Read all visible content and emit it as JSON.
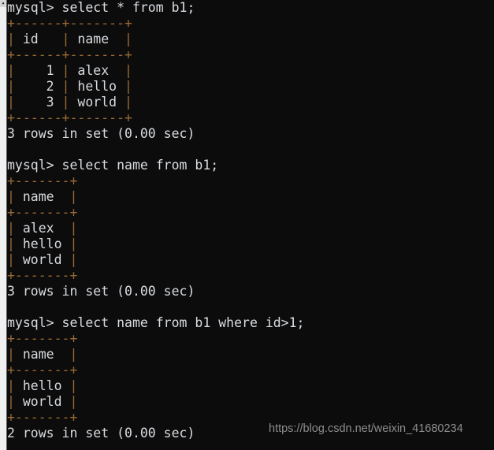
{
  "window": {
    "background_color": "#0c0c0c",
    "text_color": "#d8dbe0",
    "rule_color": "#9a6a33",
    "scrollbar_color": "#f0f0f0"
  },
  "scrollbar": {
    "up_arrow_glyph": "▲",
    "name": "vertical-scrollbar"
  },
  "terminal": {
    "lines": [
      {
        "type": "prompt",
        "text": "mysql> select * from b1;"
      },
      {
        "type": "rule",
        "text": "+------+-------+"
      },
      {
        "type": "row",
        "text": "| id   | name  |"
      },
      {
        "type": "rule",
        "text": "+------+-------+"
      },
      {
        "type": "row",
        "text": "|    1 | alex  |"
      },
      {
        "type": "row",
        "text": "|    2 | hello |"
      },
      {
        "type": "row",
        "text": "|    3 | world |"
      },
      {
        "type": "rule",
        "text": "+------+-------+"
      },
      {
        "type": "status",
        "text": "3 rows in set (0.00 sec)"
      },
      {
        "type": "blank",
        "text": " "
      },
      {
        "type": "prompt",
        "text": "mysql> select name from b1;"
      },
      {
        "type": "rule",
        "text": "+-------+"
      },
      {
        "type": "row",
        "text": "| name  |"
      },
      {
        "type": "rule",
        "text": "+-------+"
      },
      {
        "type": "row",
        "text": "| alex  |"
      },
      {
        "type": "row",
        "text": "| hello |"
      },
      {
        "type": "row",
        "text": "| world |"
      },
      {
        "type": "rule",
        "text": "+-------+"
      },
      {
        "type": "status",
        "text": "3 rows in set (0.00 sec)"
      },
      {
        "type": "blank",
        "text": " "
      },
      {
        "type": "prompt",
        "text": "mysql> select name from b1 where id>1;"
      },
      {
        "type": "rule",
        "text": "+-------+"
      },
      {
        "type": "row",
        "text": "| name  |"
      },
      {
        "type": "rule",
        "text": "+-------+"
      },
      {
        "type": "row",
        "text": "| hello |"
      },
      {
        "type": "row",
        "text": "| world |"
      },
      {
        "type": "rule",
        "text": "+-------+"
      },
      {
        "type": "status",
        "text": "2 rows in set (0.00 sec)"
      }
    ]
  },
  "queries": [
    {
      "sql": "select * from b1;",
      "columns": [
        "id",
        "name"
      ],
      "rows": [
        [
          "1",
          "alex"
        ],
        [
          "2",
          "hello"
        ],
        [
          "3",
          "world"
        ]
      ],
      "result": "3 rows in set (0.00 sec)"
    },
    {
      "sql": "select name from b1;",
      "columns": [
        "name"
      ],
      "rows": [
        [
          "alex"
        ],
        [
          "hello"
        ],
        [
          "world"
        ]
      ],
      "result": "3 rows in set (0.00 sec)"
    },
    {
      "sql": "select name from b1 where id>1;",
      "columns": [
        "name"
      ],
      "rows": [
        [
          "hello"
        ],
        [
          "world"
        ]
      ],
      "result": "2 rows in set (0.00 sec)"
    }
  ],
  "watermark": {
    "text": "https://blog.csdn.net/weixin_41680234"
  }
}
